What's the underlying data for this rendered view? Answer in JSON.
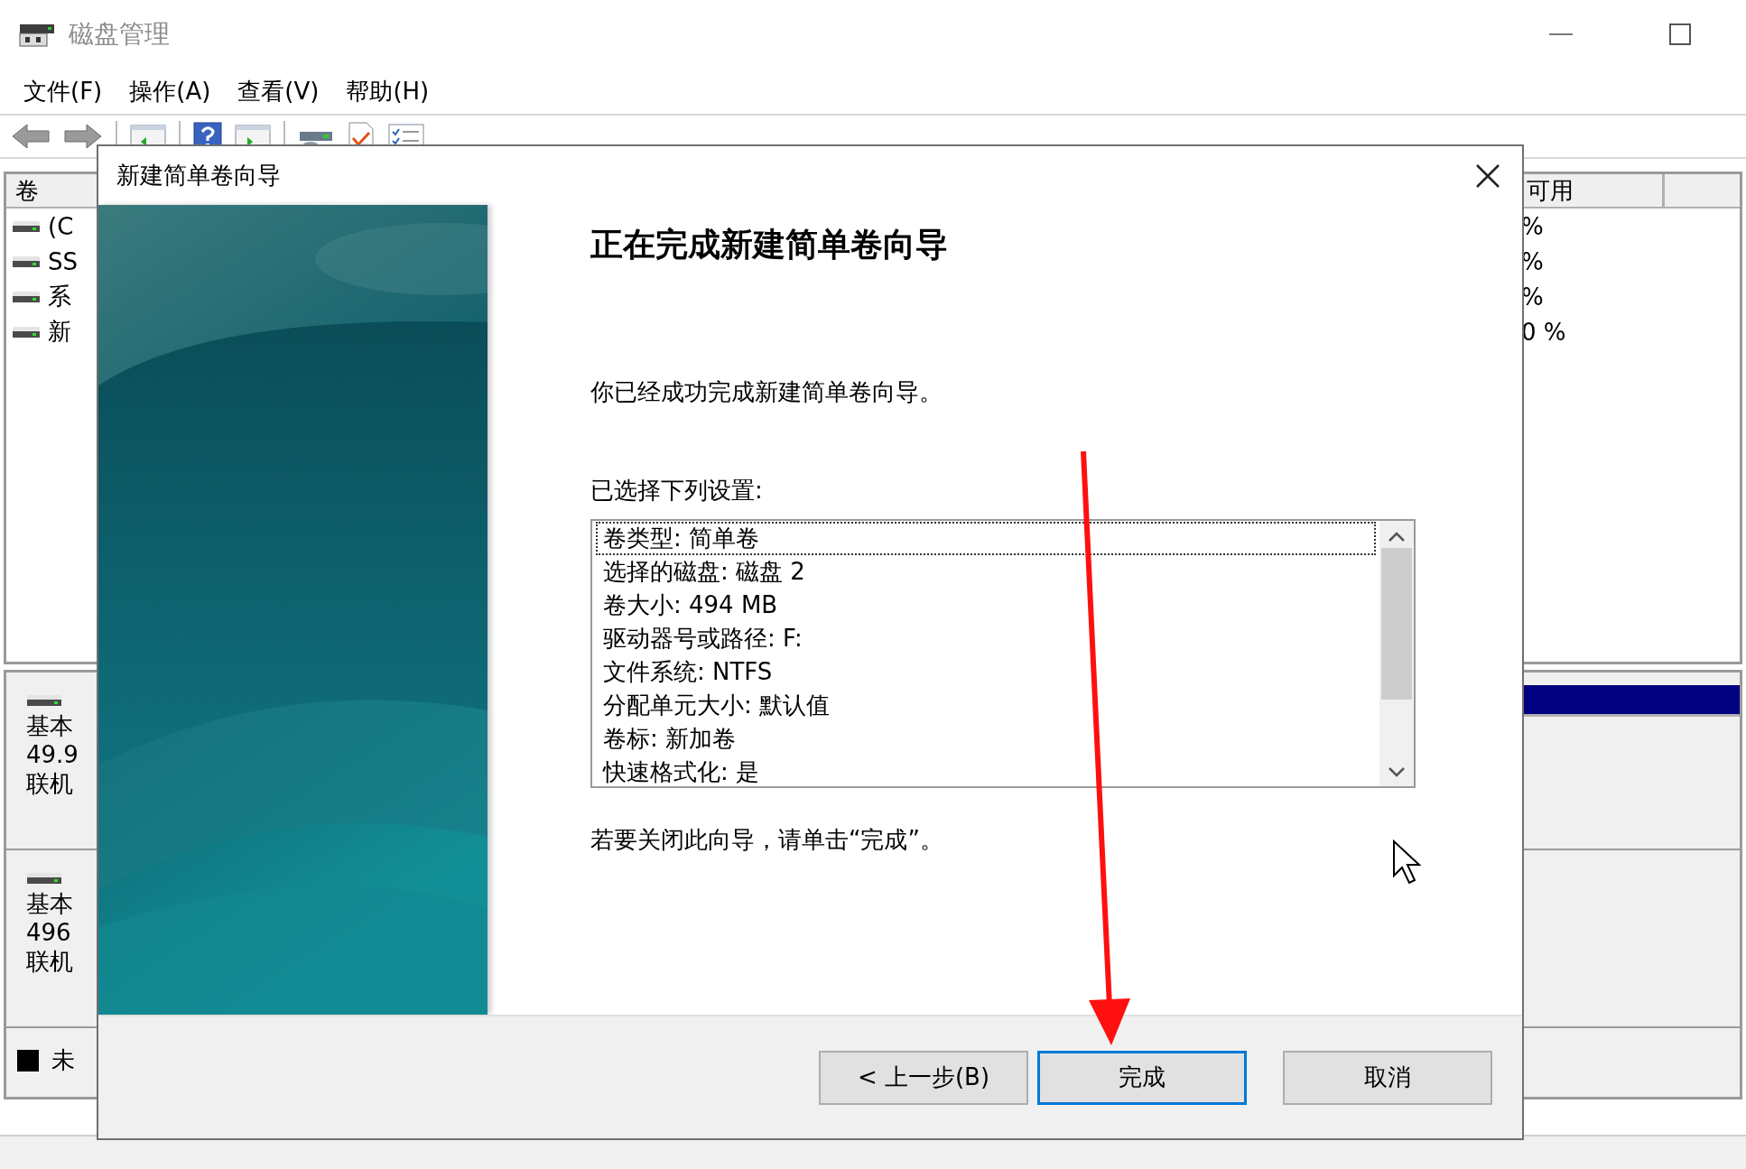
{
  "window": {
    "title": "磁盘管理"
  },
  "menu": [
    {
      "label": "文件(F)"
    },
    {
      "label": "操作(A)"
    },
    {
      "label": "查看(V)"
    },
    {
      "label": "帮助(H)"
    }
  ],
  "volume_list": {
    "columns": [
      {
        "label": "卷"
      },
      {
        "label": "可用"
      }
    ],
    "rows": [
      {
        "name": "(C",
        "free": "%"
      },
      {
        "name": "SS",
        "free": "%"
      },
      {
        "name": "系",
        "free": "%"
      },
      {
        "name": "新",
        "free": "0 %"
      }
    ]
  },
  "disks": [
    {
      "type": "基本",
      "size": "49.9",
      "status": "联机"
    },
    {
      "type": "基本",
      "size": "496",
      "status": "联机"
    }
  ],
  "legend": {
    "label": "未"
  },
  "dialog": {
    "title": "新建简单卷向导",
    "heading": "正在完成新建简单卷向导",
    "intro": "你已经成功完成新建简单卷向导。",
    "settings_label": "已选择下列设置:",
    "settings": [
      {
        "text": "卷类型: 简单卷",
        "selected": true
      },
      {
        "text": "选择的磁盘: 磁盘 2",
        "selected": false
      },
      {
        "text": "卷大小: 494 MB",
        "selected": false
      },
      {
        "text": "驱动器号或路径: F:",
        "selected": false
      },
      {
        "text": "文件系统: NTFS",
        "selected": false
      },
      {
        "text": "分配单元大小: 默认值",
        "selected": false
      },
      {
        "text": "卷标: 新加卷",
        "selected": false
      },
      {
        "text": "快速格式化: 是",
        "selected": false
      }
    ],
    "closing": "若要关闭此向导，请单击“完成”。",
    "buttons": [
      {
        "label": "< 上一步(B)",
        "kind": "back"
      },
      {
        "label": "完成",
        "kind": "default"
      },
      {
        "label": "取消",
        "kind": "cancel"
      }
    ]
  }
}
